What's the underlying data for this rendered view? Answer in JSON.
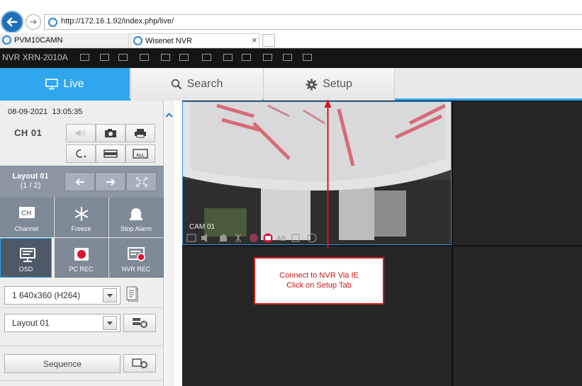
{
  "browser": {
    "url": "http://172.16.1.92/index.php/live/",
    "tabs": [
      {
        "label": "PVM10CAMN",
        "active": false
      },
      {
        "label": "Wisenet NVR",
        "active": true
      }
    ],
    "close_glyph": "×"
  },
  "nvr": {
    "model": "NVR XRN-2010A",
    "header_icons": [
      "wrench-icon",
      "hdd-icon",
      "hdd-full-icon",
      "hdd-no-icon",
      "hdd-fail-icon",
      "record-icon",
      "network-cost-icon",
      "monitor-icon",
      "display-icon",
      "tv-off-icon",
      "fan-icon",
      "layers-icon"
    ]
  },
  "nav": {
    "tabs": [
      {
        "label": "Live",
        "icon": "monitor-icon",
        "active": true
      },
      {
        "label": "Search",
        "icon": "search-icon",
        "active": false
      },
      {
        "label": "Setup",
        "icon": "gear-icon",
        "active": false
      }
    ]
  },
  "left_panel": {
    "date": "08-09-2021",
    "time": "13:05:35",
    "channel": "CH 01",
    "layout": {
      "name": "Layout 01",
      "page": "(1 / 2)"
    },
    "functions": [
      {
        "label": "Channel",
        "icon": "ch-icon"
      },
      {
        "label": "Freeze",
        "icon": "snowflake-icon"
      },
      {
        "label": "Stop Alarm",
        "icon": "alarm-bell-icon"
      },
      {
        "label": "OSD",
        "icon": "osd-icon",
        "active": true
      },
      {
        "label": "PC REC",
        "icon": "record-dot-icon"
      },
      {
        "label": "NVR REC",
        "icon": "nvr-record-icon"
      }
    ],
    "ch_icon_text": "CH",
    "stream_select": "1 640x360 (H264)",
    "layout_select": "Layout 01",
    "sequence_label": "Sequence",
    "all_tag": "ALL"
  },
  "video": {
    "cam_label": "CAM 01"
  },
  "callout": {
    "line1": "Connect to NVR Via IE",
    "line2": "Click on Setup Tab"
  },
  "colors": {
    "accent": "#2fa6ee",
    "annotation": "#d21b1b"
  }
}
